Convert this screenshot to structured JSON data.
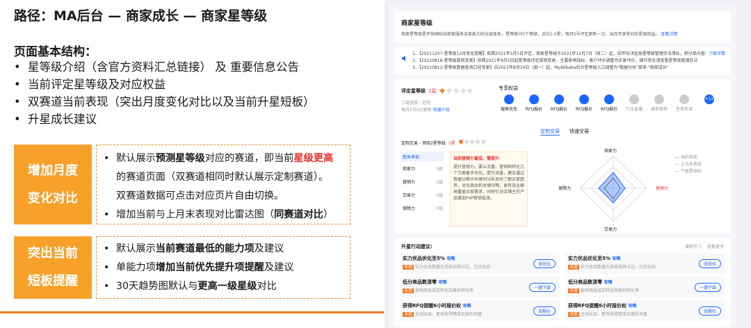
{
  "left": {
    "path_title": "路径：MA后台 — 商家成长 — 商家星等级",
    "section_title": "页面基本结构：",
    "bullets": [
      "星等级介绍（含官方资料汇总链接） 及 重要信息公告",
      "当前评定星等级及对应权益",
      "双赛道当前表现（突出月度变化对比以及当前升星短板）",
      "升星成长建议"
    ],
    "box1": {
      "label_line1": "增加月度",
      "label_line2": "变化对比",
      "b1_a": "默认展示",
      "b1_b": "预测星等级",
      "b1_c": "对应的赛道，即当前",
      "b1_d": "星级更高",
      "b1_line2": "的赛道页面（双赛道相同时默认展示定制赛道）。",
      "b1_line3": "双赛道数据可点击对应页片自由切换。",
      "b2_a": "增加当前与上月末表现对比雷达图（",
      "b2_b": "同赛道对比",
      "b2_c": "）"
    },
    "box2": {
      "label_line1": "突出当前",
      "label_line2": "短板提醒",
      "b1_a": "默认展示",
      "b1_b": "当前赛道最低的能力项",
      "b1_c": "及建议",
      "b2_a": "单能力项",
      "b2_b": "增加当前优先提升项提醒",
      "b2_c": "及建议",
      "b3_a": "30天趋势图默认与",
      "b3_b": "更高一级星级",
      "b3_c": "对比"
    }
  },
  "right": {
    "header_title": "商家星等级",
    "header_desc": "商家星等级是评估国际站商家服务买家能力的分层体系，星等级分5个等级，对应1-5星，每月5号评定更新一次，当月可享受对应星级权益。",
    "header_link": "查看详情",
    "notices": [
      "1、【20211207-星等级12月变化提醒】依照2021年5月5日评定，商家星等级于2021年12月7日（周二）起，因年份决定按星等级管理办法清标，积分单向查询对应权益与星等级变动",
      "2、【20210818-星等级规则变更】依照2021年9月5日起星等级评定规则变更，主要影响指标：客户评价调整为买家评价，细节变化请查看星等级管理办法",
      "3、【20210812-星等级数据查询口径变更】自2021年8月16日（周一）起，MyAlibaba后台星等级入口调整为\"数据分析\"菜单-\"商家成长\""
    ],
    "notice_link": "了解详情",
    "rating_label": "评定星等级",
    "rating_value": "1星",
    "rating_sub1": "二级资质：定制",
    "rating_sub2": "每月5号0点更新",
    "rating_link": "快速介绍",
    "rights_label": "专享权益",
    "rights": [
      "搜索优先",
      "RFQ报价",
      "RFQ报价",
      "RFQ报价",
      "RFQ报价",
      "行业直播",
      "搜索推荐",
      "生意参谋",
      "+12"
    ],
    "tabs": [
      "定制交易",
      "快速交易"
    ],
    "track_label": "定制交易 - 预测2星等级",
    "track_star": "1星",
    "overall_label": "整体表现",
    "ability_rows": [
      {
        "name": "商家力",
        "level": "3级"
      },
      {
        "name": "营销力",
        "level": "1级"
      },
      {
        "name": "交易力",
        "level": "3级"
      },
      {
        "name": "保障力",
        "level": "3级"
      }
    ],
    "tip_title": "当前营销力最低，需提升",
    "tip_body": "提升营销力，要从流量、营销和转化几个方面着手优化，提升流量，建议通过数据诊断中关键词分析及时了解买家趋势，优化商品和关键词等，更有效全面地覆盖买家需求，同时针对店铺主打产品增加P4P营销投放。",
    "radar_labels": {
      "top": "商家力",
      "right": "营销力",
      "bottom": "交易力",
      "left": "保障力"
    },
    "legend": [
      "当前表现",
      "上月末表现",
      "下届星级标"
    ],
    "actions_title": "升星行动建议:",
    "actions_links": [
      "课程学习",
      "查看更多"
    ],
    "actions": [
      {
        "title": "实力优品优化至5%",
        "tag": "攻略",
        "badge": "未提",
        "desc": "实力优品数量在商家品牌占比，已优化后",
        "btn": "去优化"
      },
      {
        "title": "实力优品优化至5%",
        "tag": "攻略",
        "badge": "未提",
        "desc": "实力优品数量在商家品牌占比，已优化后",
        "btn": "去优化"
      },
      {
        "title": "低分商品数清零",
        "tag": "攻略",
        "badge": "未提",
        "desc": "影响商品成交转化效果和转化率",
        "btn": "一键下架"
      },
      {
        "title": "低分商品数清零",
        "tag": "攻略",
        "badge": "未提",
        "desc": "影响商品成交转化效果和转化率",
        "btn": "一键下架"
      },
      {
        "title": "获得RFQ提醒6小时报价权",
        "tag": "攻略",
        "badge": "未提",
        "desc": "主动出击，更快获得精准买家的询盘",
        "btn": "去报价"
      },
      {
        "title": "获得RFQ提醒6小时报价权",
        "tag": "攻略",
        "badge": "未提",
        "desc": "主动出击，更快获得精准买家的询盘",
        "btn": "去报价"
      }
    ],
    "colors": {
      "accent": "#1a66ff",
      "orange": "#f7a12a",
      "red": "#e5312d"
    }
  }
}
